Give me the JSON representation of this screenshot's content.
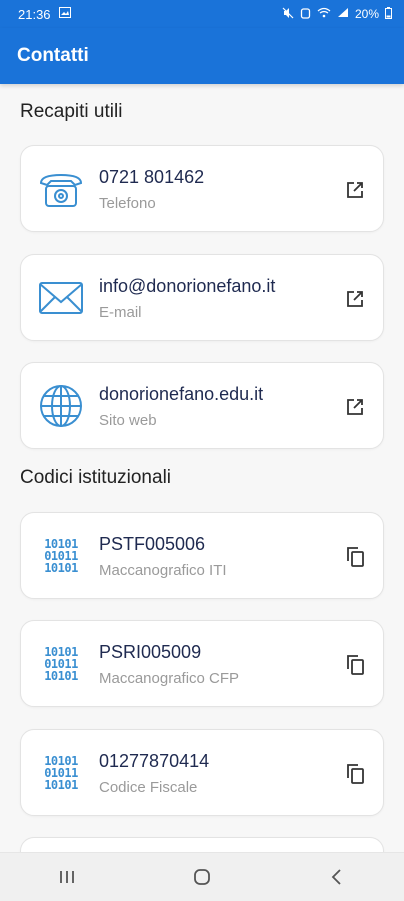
{
  "status": {
    "time": "21:36",
    "battery": "20%"
  },
  "appbar": {
    "title": "Contatti"
  },
  "sections": [
    {
      "title": "Recapiti utili"
    },
    {
      "title": "Codici istituzionali"
    }
  ],
  "contacts": [
    {
      "value": "0721 801462",
      "label": "Telefono",
      "icon": "telephone-icon",
      "action": "open-external-icon"
    },
    {
      "value": "info@donorionefano.it",
      "label": "E-mail",
      "icon": "envelope-icon",
      "action": "open-external-icon"
    },
    {
      "value": "donorionefano.edu.it",
      "label": "Sito web",
      "icon": "globe-icon",
      "action": "open-external-icon"
    }
  ],
  "codes": [
    {
      "value": "PSTF005006",
      "label": "Maccanografico ITI",
      "icon": "binary-code-icon",
      "action": "copy-icon"
    },
    {
      "value": "PSRI005009",
      "label": "Maccanografico CFP",
      "icon": "binary-code-icon",
      "action": "copy-icon"
    },
    {
      "value": "01277870414",
      "label": "Codice Fiscale",
      "icon": "binary-code-icon",
      "action": "copy-icon"
    }
  ],
  "binary_glyph": [
    "10101",
    "01011",
    "10101"
  ],
  "colors": {
    "primary": "#1a73d9",
    "icon": "#3a8fd1"
  }
}
